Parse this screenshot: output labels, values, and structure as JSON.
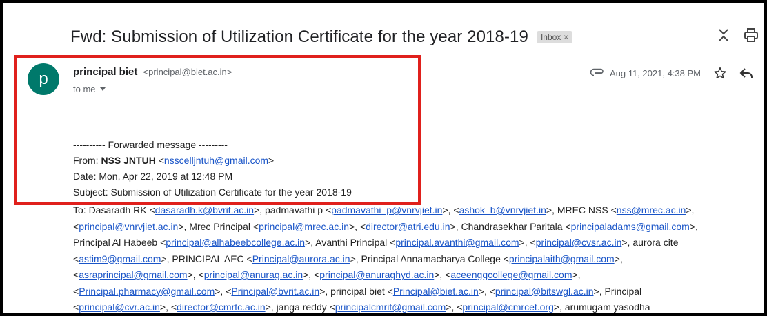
{
  "email": {
    "subject": "Fwd: Submission of Utilization Certificate for the year 2018-19",
    "label": "Inbox",
    "label_close": "×",
    "avatar_letter": "p",
    "sender_name": "principal biet",
    "sender_email": "<principal@biet.ac.in>",
    "recipient": "to me",
    "date": "Aug 11, 2021, 4:38 PM"
  },
  "forwarded": {
    "header": "---------- Forwarded message ---------",
    "from_label": "From: ",
    "from_name": "NSS JNTUH",
    "from_open": " <",
    "from_email": "nsscelljntuh@gmail.com",
    "from_close": ">",
    "date_line": "Date: Mon, Apr 22, 2019 at 12:48 PM",
    "subject_line": "Subject: Submission of Utilization Certificate for the year 2018-19"
  },
  "to_lines": [
    [
      {
        "t": "To: Dasaradh RK <"
      },
      {
        "t": "dasaradh.k@bvrit.ac.in",
        "link": true
      },
      {
        "t": ">, padmavathi p <"
      },
      {
        "t": "padmavathi_p@vnrvjiet.in",
        "link": true
      },
      {
        "t": ">, <"
      },
      {
        "t": "ashok_b@vnrvjiet.in",
        "link": true
      },
      {
        "t": ">, MREC NSS <"
      },
      {
        "t": "nss@mrec.ac.in",
        "link": true
      },
      {
        "t": ">,"
      }
    ],
    [
      {
        "t": "<"
      },
      {
        "t": "principal@vnrvjiet.ac.in",
        "link": true
      },
      {
        "t": ">, Mrec Principal <"
      },
      {
        "t": "principal@mrec.ac.in",
        "link": true
      },
      {
        "t": ">, <"
      },
      {
        "t": "director@atri.edu.in",
        "link": true
      },
      {
        "t": ">, Chandrasekhar Paritala <"
      },
      {
        "t": "principaladams@gmail.com",
        "link": true
      },
      {
        "t": ">,"
      }
    ],
    [
      {
        "t": "Principal Al Habeeb <"
      },
      {
        "t": "principal@alhabeebcollege.ac.in",
        "link": true
      },
      {
        "t": ">, Avanthi Principal <"
      },
      {
        "t": "principal.avanthi@gmail.com",
        "link": true
      },
      {
        "t": ">, <"
      },
      {
        "t": "principal@cvsr.ac.in",
        "link": true
      },
      {
        "t": ">, aurora cite"
      }
    ],
    [
      {
        "t": "<"
      },
      {
        "t": "astim9@gmail.com",
        "link": true
      },
      {
        "t": ">, PRINCIPAL AEC <"
      },
      {
        "t": "Principal@aurora.ac.in",
        "link": true
      },
      {
        "t": ">, Principal Annamacharya College <"
      },
      {
        "t": "principalaith@gmail.com",
        "link": true
      },
      {
        "t": ">,"
      }
    ],
    [
      {
        "t": "<"
      },
      {
        "t": "asraprincipal@gmail.com",
        "link": true
      },
      {
        "t": ">, <"
      },
      {
        "t": "principal@anurag.ac.in",
        "link": true
      },
      {
        "t": ">, <"
      },
      {
        "t": "principal@anuraghyd.ac.in",
        "link": true
      },
      {
        "t": ">, <"
      },
      {
        "t": "aceenggcollege@gmail.com",
        "link": true
      },
      {
        "t": ">,"
      }
    ],
    [
      {
        "t": "<"
      },
      {
        "t": "Principal.pharmacy@gmail.com",
        "link": true
      },
      {
        "t": ">, <"
      },
      {
        "t": "Principal@bvrit.ac.in",
        "link": true
      },
      {
        "t": ">, principal biet <"
      },
      {
        "t": "Principal@biet.ac.in",
        "link": true
      },
      {
        "t": ">, <"
      },
      {
        "t": "principal@bitswgl.ac.in",
        "link": true
      },
      {
        "t": ">, Principal"
      }
    ],
    [
      {
        "t": "<"
      },
      {
        "t": "principal@cvr.ac.in",
        "link": true
      },
      {
        "t": ">, <"
      },
      {
        "t": "director@cmrtc.ac.in",
        "link": true
      },
      {
        "t": ">, janga reddy <"
      },
      {
        "t": "principalcmrit@gmail.com",
        "link": true
      },
      {
        "t": ">, <"
      },
      {
        "t": "principal@cmrcet.org",
        "link": true
      },
      {
        "t": ">, arumugam yasodha"
      }
    ]
  ],
  "icons": {
    "expand": "expand-collapse-icon",
    "print": "print-icon",
    "attachment": "attachment-icon",
    "star": "star-icon",
    "reply": "reply-icon"
  },
  "colors": {
    "avatar": "#00796b",
    "highlight": "#e0201c",
    "link": "#1a55c8"
  }
}
